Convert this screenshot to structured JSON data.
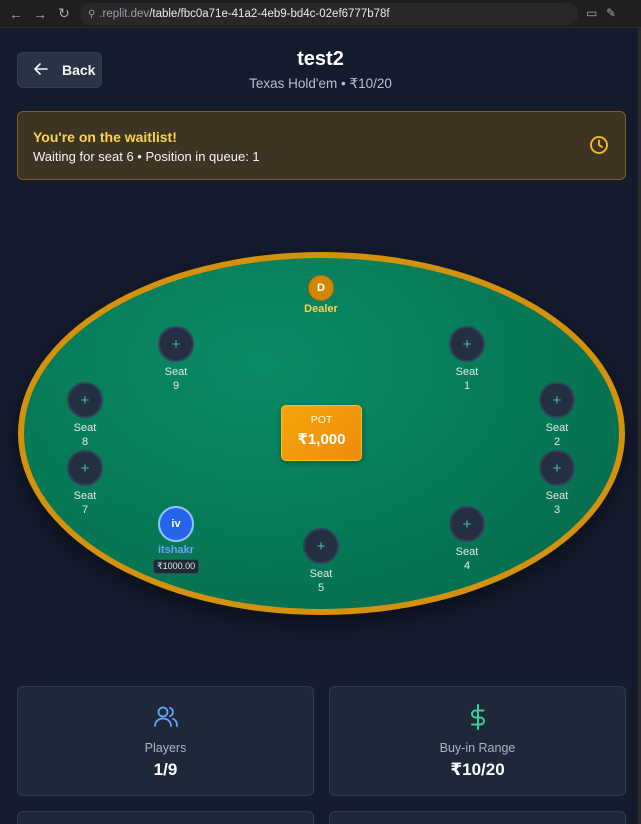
{
  "browser": {
    "url_host": ".replit.dev",
    "url_path": "/table/fbc0a71e-41a2-4eb9-bd4c-02ef6777b78f"
  },
  "header": {
    "back_label": "Back",
    "title": "test2",
    "subtitle": "Texas Hold'em • ₹10/20"
  },
  "waitlist": {
    "title": "You're on the waitlist!",
    "text": "Waiting for seat 6 • Position in queue: 1"
  },
  "table": {
    "dealer_badge": "D",
    "dealer_label": "Dealer",
    "pot_label": "POT",
    "pot_value": "₹1,000",
    "empty_seat_word": "Seat",
    "seats": [
      {
        "number": "1"
      },
      {
        "number": "2"
      },
      {
        "number": "3"
      },
      {
        "number": "4"
      },
      {
        "number": "5"
      },
      {
        "number": "7"
      },
      {
        "number": "8"
      },
      {
        "number": "9"
      }
    ],
    "player": {
      "initials": "iv",
      "name": "itshakr",
      "chips": "₹1000.00"
    }
  },
  "stats": {
    "players_label": "Players",
    "players_value": "1/9",
    "buyin_label": "Buy-in Range",
    "buyin_value": "₹10/20"
  },
  "colors": {
    "background": "#141b2d",
    "felt": "#067856",
    "rim": "#d4920c",
    "accent_teal": "#3fbf9f",
    "banner_title": "#fcd34d"
  }
}
